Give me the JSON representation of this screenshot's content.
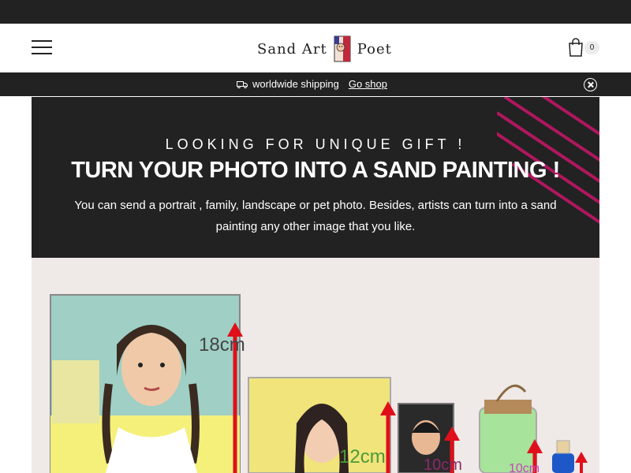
{
  "header": {
    "logo_word1": "Sand Art",
    "logo_word2": "Poet",
    "cart_count": "0"
  },
  "announcement": {
    "icon": "truck-icon",
    "text": "worldwide shipping",
    "link": "Go shop"
  },
  "hero": {
    "subtitle": "LOOKING FOR UNIQUE GIFT !",
    "title": "TURN YOUR PHOTO INTO A SAND PAINTING !",
    "text": "You can send a portrait , family, landscape or pet photo. Besides, artists can turn into a sand painting any other image that you like.",
    "accent_color": "#b0175e"
  },
  "product_photo": {
    "labels": [
      "18cm",
      "12cm",
      "10cm",
      "10cm"
    ]
  }
}
